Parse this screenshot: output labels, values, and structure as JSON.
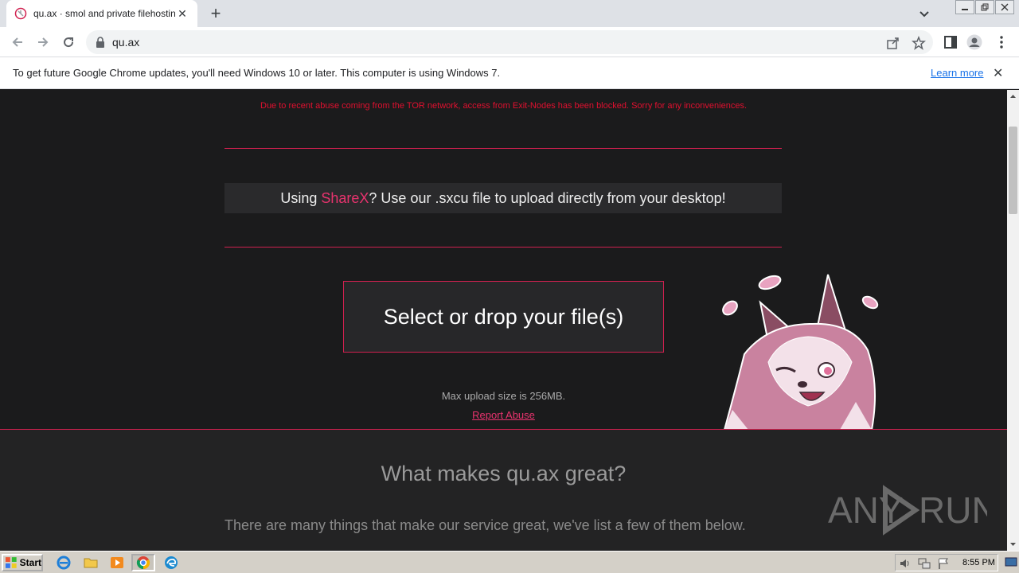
{
  "browser": {
    "tab_title": "qu.ax · smol and private filehosting",
    "url": "qu.ax"
  },
  "infobar": {
    "message": "To get future Google Chrome updates, you'll need Windows 10 or later. This computer is using Windows 7.",
    "learn_more": "Learn more"
  },
  "page": {
    "tor_notice": "Due to recent abuse coming from the TOR network, access from Exit-Nodes has been blocked. Sorry for any inconveniences.",
    "sharex_prefix": "Using ",
    "sharex_link": "ShareX",
    "sharex_suffix": "? Use our .sxcu file to upload directly from your desktop!",
    "drop_label": "Select or drop your file(s)",
    "max_upload": "Max upload size is 256MB.",
    "report_abuse": "Report Abuse",
    "section_title": "What makes qu.ax great?",
    "section_text": "There are many things that make our service great, we've list a few of them below."
  },
  "watermark": {
    "left": "ANY",
    "right": "RUN"
  },
  "taskbar": {
    "start_label": "Start",
    "clock": "8:55 PM"
  },
  "colors": {
    "accent": "#d0204f",
    "link": "#e8336e",
    "tor_red": "#e0102f",
    "page_bg": "#1b1b1c"
  }
}
